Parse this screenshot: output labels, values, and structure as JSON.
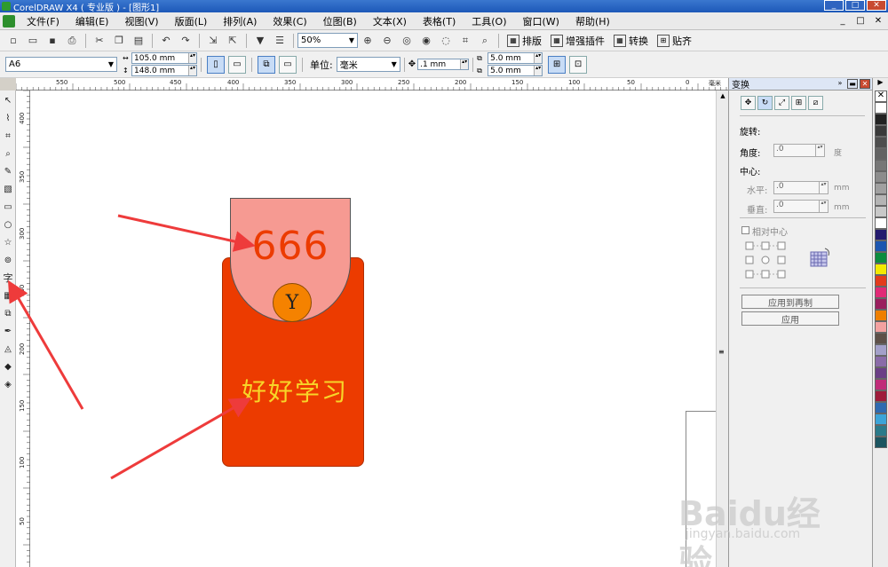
{
  "window": {
    "title": "CorelDRAW X4 ( 专业版 ) - [图形1]",
    "min": "_",
    "max": "□",
    "close": "✕"
  },
  "menu": {
    "items": [
      "文件(F)",
      "编辑(E)",
      "视图(V)",
      "版面(L)",
      "排列(A)",
      "效果(C)",
      "位图(B)",
      "文本(X)",
      "表格(T)",
      "工具(O)",
      "窗口(W)",
      "帮助(H)"
    ]
  },
  "toolbar": {
    "zoom": "50%",
    "imposition": "排版",
    "enhance": "增强插件",
    "convert": "转换",
    "paste": "贴齐"
  },
  "propertybar": {
    "paper_size": "A6",
    "width": "105.0 mm",
    "height": "148.0 mm",
    "units_label": "单位:",
    "units": "毫米",
    "nudge": ".1 mm",
    "dup_x": "5.0 mm",
    "dup_y": "5.0 mm"
  },
  "ruler": {
    "h_labels": [
      "550",
      "500",
      "450",
      "400",
      "350",
      "300",
      "250",
      "200",
      "150",
      "100",
      "50",
      "0"
    ],
    "h_unit": "毫米",
    "v_labels": [
      "400",
      "350",
      "300",
      "250",
      "200",
      "150",
      "100",
      "50"
    ]
  },
  "design": {
    "flap_text": "666",
    "coin_symbol": "Y",
    "study_text": "好好学习",
    "colors": {
      "body": "#ec3b00",
      "flap": "#f69a92",
      "coin": "#f58200",
      "study": "#f7d628"
    }
  },
  "docker": {
    "title": "变换",
    "rotation_label": "旋转:",
    "angle_label": "角度:",
    "angle_value": ".0",
    "angle_unit": "度",
    "center_label": "中心:",
    "horizontal_label": "水平:",
    "horizontal_value": ".0",
    "vertical_label": "垂直:",
    "vertical_value": ".0",
    "unit": "mm",
    "relative_center": "相对中心",
    "apply_duplicate": "应用到再制",
    "apply": "应用"
  },
  "palette": {
    "colors": [
      "#ffffff",
      "#222222",
      "#3a3a3a",
      "#4e4e4e",
      "#626262",
      "#777777",
      "#8c8c8c",
      "#a0a0a0",
      "#b4b4b4",
      "#c8c8c8",
      "#ffffff",
      "#231a6e",
      "#1c56b0",
      "#0b8c3e",
      "#f3ea00",
      "#e33b1c",
      "#e12a76",
      "#9a1f5e",
      "#ee7f00",
      "#f3a1a0",
      "#5e5048",
      "#a3a0c9",
      "#8a6ba8",
      "#6b3f86",
      "#c02c79",
      "#9e1c3a",
      "#2f6ab0",
      "#3ca4d8",
      "#2b7a8a",
      "#1c5560"
    ]
  },
  "watermark": {
    "main": "Baidu经验",
    "sub": "jingyan.baidu.com"
  }
}
